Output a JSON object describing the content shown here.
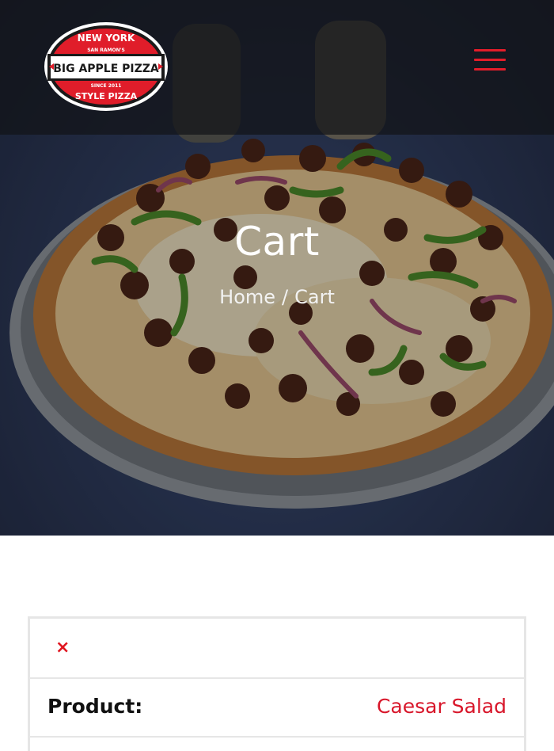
{
  "header": {
    "logo": {
      "top_arc": "NEW YORK",
      "small_text": "SAN RAMON'S",
      "main_text": "BIG APPLE PIZZA",
      "since": "SINCE 2011",
      "bottom_arc": "STYLE PIZZA"
    },
    "menu_icon": "hamburger-menu-icon"
  },
  "hero": {
    "title": "Cart",
    "breadcrumb": {
      "home": "Home",
      "separator": "/",
      "current": "Cart"
    }
  },
  "cart": {
    "remove_icon": "×",
    "product_label": "Product:",
    "product_name": "Caesar Salad"
  },
  "colors": {
    "accent": "#e21d2a",
    "product_link": "#d8162a",
    "border": "#e6e6e6"
  }
}
